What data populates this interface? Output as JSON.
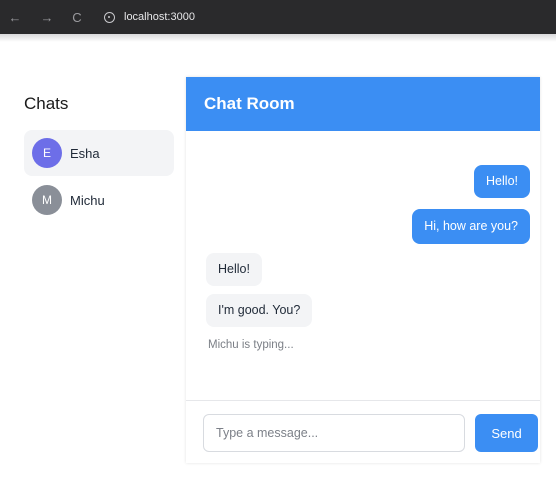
{
  "browser": {
    "back_icon": "←",
    "forward_icon": "→",
    "reload_icon": "C",
    "url": "localhost:3000"
  },
  "sidebar": {
    "title": "Chats",
    "items": [
      {
        "initial": "E",
        "name": "Esha",
        "active": true,
        "avatar_color": "#6d6ee8"
      },
      {
        "initial": "M",
        "name": "Michu",
        "active": false,
        "avatar_color": "#8a8f98"
      }
    ]
  },
  "room": {
    "title": "Chat Room",
    "messages": [
      {
        "text": "Hello!",
        "sent": true
      },
      {
        "text": "Hi, how are you?",
        "sent": true
      },
      {
        "text": "Hello!",
        "sent": false
      },
      {
        "text": "I'm good. You?",
        "sent": false
      }
    ],
    "typing_text": "Michu is typing...",
    "input_placeholder": "Type a message...",
    "input_value": "",
    "send_label": "Send"
  },
  "colors": {
    "accent": "#3b8ef3",
    "bubble_received": "#f3f4f6",
    "chrome_bar": "#2a2a2c"
  }
}
